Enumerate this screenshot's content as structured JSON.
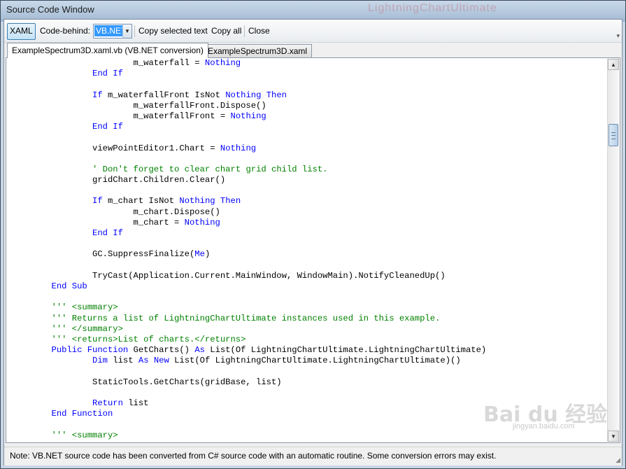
{
  "window": {
    "title": "Source Code Window",
    "background_watermark": "LightningChartUltimate"
  },
  "toolbar": {
    "xaml_label": "XAML",
    "code_behind_label": "Code-behind:",
    "language_selected": "VB.NET",
    "copy_selected_label": "Copy selected text",
    "copy_all_label": "Copy all",
    "close_label": "Close"
  },
  "tabs": [
    {
      "label": "ExampleSpectrum3D.xaml.vb (VB.NET conversion)",
      "active": true
    },
    {
      "label": "ExampleSpectrum3D.xaml",
      "active": false
    }
  ],
  "code_lines": [
    [
      {
        "t": "                        m_waterfall = "
      },
      {
        "t": "Nothing",
        "c": "kw"
      }
    ],
    [
      {
        "t": "                "
      },
      {
        "t": "End If",
        "c": "kw"
      }
    ],
    [
      {
        "t": ""
      }
    ],
    [
      {
        "t": "                "
      },
      {
        "t": "If",
        "c": "kw"
      },
      {
        "t": " m_waterfallFront IsNot "
      },
      {
        "t": "Nothing",
        "c": "kw"
      },
      {
        "t": " "
      },
      {
        "t": "Then",
        "c": "kw"
      }
    ],
    [
      {
        "t": "                        m_waterfallFront.Dispose()"
      }
    ],
    [
      {
        "t": "                        m_waterfallFront = "
      },
      {
        "t": "Nothing",
        "c": "kw"
      }
    ],
    [
      {
        "t": "                "
      },
      {
        "t": "End If",
        "c": "kw"
      }
    ],
    [
      {
        "t": ""
      }
    ],
    [
      {
        "t": "                viewPointEditor1.Chart = "
      },
      {
        "t": "Nothing",
        "c": "kw"
      }
    ],
    [
      {
        "t": ""
      }
    ],
    [
      {
        "t": "                "
      },
      {
        "t": "' Don't forget to clear chart grid child list.",
        "c": "cm"
      }
    ],
    [
      {
        "t": "                gridChart.Children.Clear()"
      }
    ],
    [
      {
        "t": ""
      }
    ],
    [
      {
        "t": "                "
      },
      {
        "t": "If",
        "c": "kw"
      },
      {
        "t": " m_chart IsNot "
      },
      {
        "t": "Nothing",
        "c": "kw"
      },
      {
        "t": " "
      },
      {
        "t": "Then",
        "c": "kw"
      }
    ],
    [
      {
        "t": "                        m_chart.Dispose()"
      }
    ],
    [
      {
        "t": "                        m_chart = "
      },
      {
        "t": "Nothing",
        "c": "kw"
      }
    ],
    [
      {
        "t": "                "
      },
      {
        "t": "End If",
        "c": "kw"
      }
    ],
    [
      {
        "t": ""
      }
    ],
    [
      {
        "t": "                GC.SuppressFinalize("
      },
      {
        "t": "Me",
        "c": "kw"
      },
      {
        "t": ")"
      }
    ],
    [
      {
        "t": ""
      }
    ],
    [
      {
        "t": "                TryCast(Application.Current.MainWindow, WindowMain).NotifyCleanedUp()"
      }
    ],
    [
      {
        "t": "        "
      },
      {
        "t": "End Sub",
        "c": "kw"
      }
    ],
    [
      {
        "t": ""
      }
    ],
    [
      {
        "t": "        "
      },
      {
        "t": "''' <summary>",
        "c": "cm"
      }
    ],
    [
      {
        "t": "        "
      },
      {
        "t": "''' Returns a list of LightningChartUltimate instances used in this example.",
        "c": "cm"
      }
    ],
    [
      {
        "t": "        "
      },
      {
        "t": "''' </summary>",
        "c": "cm"
      }
    ],
    [
      {
        "t": "        "
      },
      {
        "t": "''' <returns>List of charts.</returns>",
        "c": "cm"
      }
    ],
    [
      {
        "t": "        "
      },
      {
        "t": "Public Function",
        "c": "kw"
      },
      {
        "t": " GetCharts() "
      },
      {
        "t": "As",
        "c": "kw"
      },
      {
        "t": " List(Of LightningChartUltimate.LightningChartUltimate)"
      }
    ],
    [
      {
        "t": "                "
      },
      {
        "t": "Dim",
        "c": "kw"
      },
      {
        "t": " list "
      },
      {
        "t": "As",
        "c": "kw"
      },
      {
        "t": " "
      },
      {
        "t": "New",
        "c": "kw"
      },
      {
        "t": " List(Of LightningChartUltimate.LightningChartUltimate)()"
      }
    ],
    [
      {
        "t": ""
      }
    ],
    [
      {
        "t": "                StaticTools.GetCharts(gridBase, list)"
      }
    ],
    [
      {
        "t": ""
      }
    ],
    [
      {
        "t": "                "
      },
      {
        "t": "Return",
        "c": "kw"
      },
      {
        "t": " list"
      }
    ],
    [
      {
        "t": "        "
      },
      {
        "t": "End Function",
        "c": "kw"
      }
    ],
    [
      {
        "t": ""
      }
    ],
    [
      {
        "t": "        "
      },
      {
        "t": "''' <summary>",
        "c": "cm"
      }
    ]
  ],
  "colors": {
    "keyword": "#0000ff",
    "comment": "#008000"
  },
  "status": {
    "note": "Note: VB.NET source code has been converted from C# source code with an automatic routine. Some conversion errors may exist."
  },
  "watermark": {
    "brand": "Bai du 经验",
    "url": "jingyan.baidu.com"
  }
}
